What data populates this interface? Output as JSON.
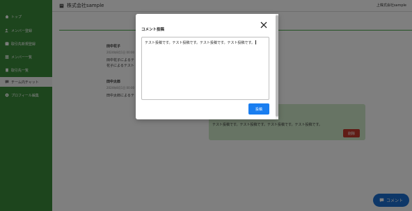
{
  "sidebar": {
    "items": [
      {
        "label": "トップ",
        "icon": "home-icon"
      },
      {
        "label": "メンバー登録",
        "icon": "user-add-icon"
      },
      {
        "label": "取引先新規登録",
        "icon": "store-icon"
      },
      {
        "label": "メンバー一覧",
        "icon": "users-icon"
      },
      {
        "label": "取引先一覧",
        "icon": "building-icon"
      },
      {
        "label": "チーム内チャット",
        "icon": "chat-icon"
      },
      {
        "label": "プロフィール編集",
        "icon": "gear-icon"
      }
    ],
    "active_index": 5
  },
  "header": {
    "company": "株式会社sample",
    "user": "上株式会社sample"
  },
  "messages": [
    {
      "name": "田中花子",
      "time": "2024年8月1日 00:00",
      "lines": [
        "田中花子によるテ",
        "花子によるテスト"
      ]
    },
    {
      "name": "田中太郎",
      "time": "2024年8月1日 00:00",
      "lines": [
        "田中太郎によるテ"
      ]
    }
  ],
  "reply": {
    "text": "テスト投稿です。テスト投稿です。テスト投稿です。テスト投稿です。",
    "delete_label": "削除"
  },
  "fab": {
    "label": "コメント",
    "icon": "chat-bubble-icon"
  },
  "modal": {
    "title": "コメント投稿",
    "textarea_value": "テスト投稿です。テスト投稿です。テスト投稿です。テスト投稿です。",
    "submit_label": "投稿",
    "close_icon": "close-icon"
  },
  "colors": {
    "sidebar": "#3a8a3a",
    "accent_line": "#4aa44a",
    "primary": "#1a7ef0",
    "danger": "#c0392b",
    "reply_bg": "#cfe8c8",
    "fab": "#1a6fd1"
  }
}
